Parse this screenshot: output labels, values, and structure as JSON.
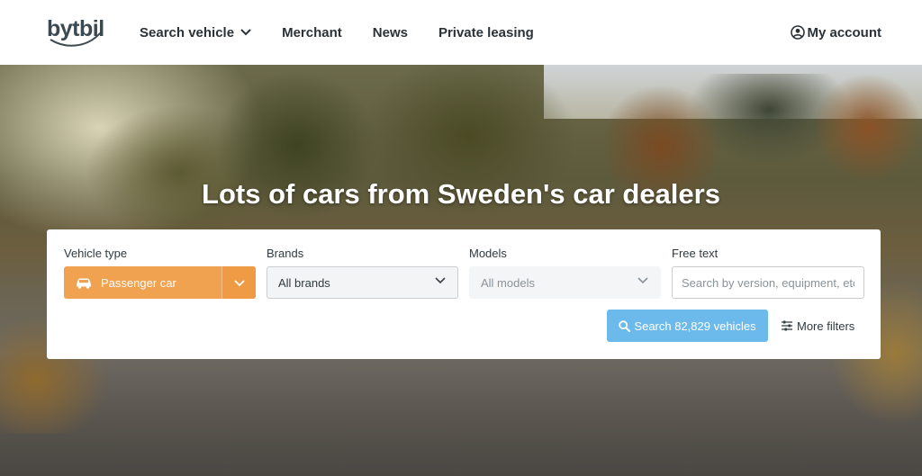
{
  "header": {
    "logo_text": "bytbil",
    "nav": [
      {
        "label": "Search vehicle"
      },
      {
        "label": "Merchant"
      },
      {
        "label": "News"
      },
      {
        "label": "Private leasing"
      }
    ],
    "account_label": "My account"
  },
  "hero": {
    "title": "Lots of cars from Sweden's car dealers"
  },
  "search": {
    "vehicle_type": {
      "label": "Vehicle type",
      "value": "Passenger car",
      "icon": "car-icon"
    },
    "brands": {
      "label": "Brands",
      "value": "All brands"
    },
    "models": {
      "label": "Models",
      "value": "All models"
    },
    "free_text": {
      "label": "Free text",
      "placeholder": "Search by version, equipment, etc",
      "value": ""
    },
    "search_button_label": "Search 82,829 vehicles",
    "more_filters_label": "More filters"
  },
  "colors": {
    "accent_orange": "#f1a251",
    "button_blue": "#6cb9ec",
    "text_dark": "#2a3238"
  }
}
